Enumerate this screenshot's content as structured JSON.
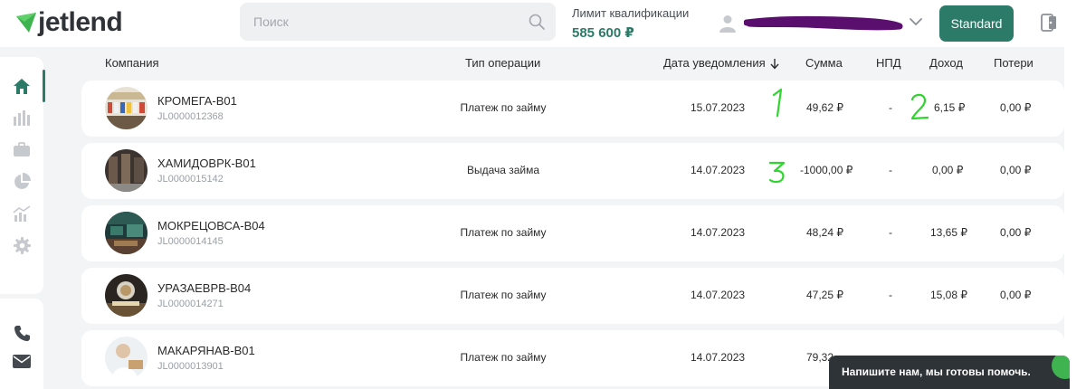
{
  "header": {
    "logo_text": "jetlend",
    "search": {
      "placeholder": "Поиск",
      "value": ""
    },
    "limit": {
      "label": "Лимит квалификации",
      "value": "585 600 ₽"
    },
    "plan_button": "Standard"
  },
  "colors": {
    "brand": "#2b7b68",
    "logo_green": "#3fb34f",
    "background": "#f3f4f6",
    "scribble": "#5a0e6e",
    "annotation": "#2fd52f",
    "chat_bg": "#2e3338"
  },
  "sidebar": {
    "items": [
      {
        "icon": "home-icon",
        "active": true
      },
      {
        "icon": "bar-chart-icon",
        "active": false
      },
      {
        "icon": "briefcase-icon",
        "active": false
      },
      {
        "icon": "pie-chart-icon",
        "active": false
      },
      {
        "icon": "growth-chart-icon",
        "active": false
      },
      {
        "icon": "gear-icon",
        "active": false
      }
    ],
    "bottom": [
      {
        "icon": "phone-icon"
      },
      {
        "icon": "mail-icon"
      }
    ]
  },
  "table": {
    "columns": {
      "company": "Компания",
      "operation": "Тип операции",
      "date": "Дата уведомления",
      "amount": "Сумма",
      "npd": "НПД",
      "income": "Доход",
      "losses": "Потери"
    },
    "rows": [
      {
        "name": "КРОМЕГА-В01",
        "code": "JL0000012368",
        "operation": "Платеж по займу",
        "date": "15.07.2023",
        "amount": "49,62 ₽",
        "npd": "-",
        "income": "6,15 ₽",
        "losses": "0,00 ₽"
      },
      {
        "name": "ХАМИДОВРК-В01",
        "code": "JL0000015142",
        "operation": "Выдача займа",
        "date": "14.07.2023",
        "amount": "-1000,00 ₽",
        "npd": "-",
        "income": "0,00 ₽",
        "losses": "0,00 ₽"
      },
      {
        "name": "МОКРЕЦОВСА-В04",
        "code": "JL0000014145",
        "operation": "Платеж по займу",
        "date": "14.07.2023",
        "amount": "48,24 ₽",
        "npd": "-",
        "income": "13,65 ₽",
        "losses": "0,00 ₽"
      },
      {
        "name": "УРАЗАЕВРВ-В04",
        "code": "JL0000014271",
        "operation": "Платеж по займу",
        "date": "14.07.2023",
        "amount": "47,25 ₽",
        "npd": "-",
        "income": "15,08 ₽",
        "losses": "0,00 ₽"
      },
      {
        "name": "МАКАРЯНАВ-В01",
        "code": "JL0000013901",
        "operation": "Платеж по займу",
        "date": "14.07.2023",
        "amount": "79,32",
        "npd": "",
        "income": "",
        "losses": ""
      }
    ]
  },
  "annotations": [
    "1",
    "2",
    "3"
  ],
  "chat": {
    "text": "Напишите нам, мы готовы помочь."
  }
}
